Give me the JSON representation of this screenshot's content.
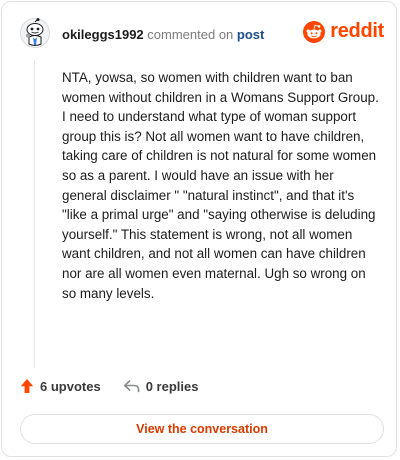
{
  "header": {
    "username": "okileggs1992",
    "action_text": "commented on",
    "post_link": "post"
  },
  "logo": {
    "text": "reddit",
    "color": "#ff4500"
  },
  "comment": {
    "text": "NTA, yowsa, so women with children want to ban women without children in a Womans Support Group. I need to understand what type of woman support group this is? Not all women want to have children, taking care of children is not natural for some women so as a parent. I would have an issue with her general disclaimer \" \"natural instinct\", and that it's \"like a primal urge\" and \"saying otherwise is deluding yourself.\" This statement is wrong, not all women want children, and not all women can have children nor are all women even maternal. Ugh so wrong on so many levels."
  },
  "actions": {
    "upvotes": "6 upvotes",
    "replies": "0 replies",
    "upvote_icon": "upvote-arrow-icon",
    "reply_icon": "reply-arrow-icon"
  },
  "cta": {
    "label": "View the conversation"
  },
  "colors": {
    "accent": "#ff4500",
    "link": "#1a4f8e",
    "button_text": "#d93a00"
  }
}
